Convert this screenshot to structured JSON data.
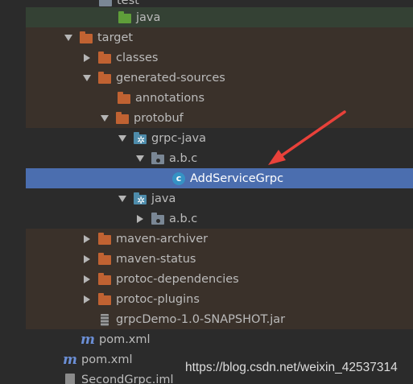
{
  "tree": {
    "rows": [
      {
        "label": "test",
        "indent": 1,
        "arrow": "none",
        "icon": "folder-gray"
      },
      {
        "label": "java",
        "indent": 3,
        "arrow": "none",
        "icon": "folder-green"
      },
      {
        "label": "target",
        "indent": 2,
        "arrow": "down",
        "icon": "folder-orange"
      },
      {
        "label": "classes",
        "indent": 3,
        "arrow": "right",
        "icon": "folder-orange"
      },
      {
        "label": "generated-sources",
        "indent": 3,
        "arrow": "down",
        "icon": "folder-orange"
      },
      {
        "label": "annotations",
        "indent": 4,
        "arrow": "none",
        "icon": "folder-orange"
      },
      {
        "label": "protobuf",
        "indent": 4,
        "arrow": "down",
        "icon": "folder-orange"
      },
      {
        "label": "grpc-java",
        "indent": 5,
        "arrow": "down",
        "icon": "folder-source"
      },
      {
        "label": "a.b.c",
        "indent": 6,
        "arrow": "down",
        "icon": "package"
      },
      {
        "label": "AddServiceGrpc",
        "indent": 7,
        "arrow": "none",
        "icon": "class",
        "selected": true
      },
      {
        "label": "java",
        "indent": 5,
        "arrow": "down",
        "icon": "folder-source"
      },
      {
        "label": "a.b.c",
        "indent": 6,
        "arrow": "right",
        "icon": "package"
      },
      {
        "label": "maven-archiver",
        "indent": 3,
        "arrow": "right",
        "icon": "folder-orange"
      },
      {
        "label": "maven-status",
        "indent": 3,
        "arrow": "right",
        "icon": "folder-orange"
      },
      {
        "label": "protoc-dependencies",
        "indent": 3,
        "arrow": "right",
        "icon": "folder-orange"
      },
      {
        "label": "protoc-plugins",
        "indent": 3,
        "arrow": "right",
        "icon": "folder-orange"
      },
      {
        "label": "grpcDemo-1.0-SNAPSHOT.jar",
        "indent": 3,
        "arrow": "none",
        "icon": "jar"
      },
      {
        "label": "pom.xml",
        "indent": 2,
        "arrow": "none",
        "icon": "maven"
      },
      {
        "label": "pom.xml",
        "indent": 1,
        "arrow": "none",
        "icon": "maven"
      },
      {
        "label": "SecondGrpc.iml",
        "indent": 1,
        "arrow": "none",
        "icon": "iml"
      }
    ]
  },
  "watermark": "https://blog.csdn.net/weixin_42537314",
  "colors": {
    "background": "#2b2b2b",
    "selection": "#4b6eaf",
    "annotation_arrow": "#e8413a",
    "folder": "#c06232"
  }
}
